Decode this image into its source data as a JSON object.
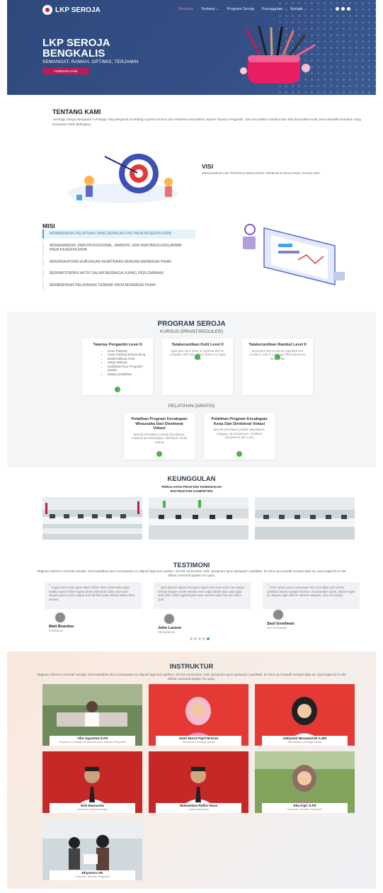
{
  "brand": {
    "name": "LKP SEROJA",
    "accent": "#c2185b",
    "hero_bg": "#344f85"
  },
  "nav": {
    "items": [
      {
        "label": "Beranda",
        "active": true
      },
      {
        "label": "Tentang ⌄",
        "active": false
      },
      {
        "label": "Program Seroja",
        "active": false
      },
      {
        "label": "Keunggulan",
        "active": false
      },
      {
        "label": "Kontak",
        "active": false
      }
    ],
    "social_icons": [
      "twitter-icon",
      "facebook-icon",
      "instagram-icon"
    ]
  },
  "hero": {
    "title": "LKP SEROJA BENGKALIS",
    "subtitle": "SEMANGAT, RAMAH, OPTIMIS, TERJAMIN",
    "button_label": "HUBUNGI KAMI"
  },
  "tentang": {
    "title": "TENTANG KAMI",
    "description": "Lembaga Seroja Merupakan Lembaga Yang Bergerak Di Bidang Layanan Kursus Dan Pelatihan Kecantikan Seperti Tatarias Pengantin, Tata Kecantikan Rambut Dan Tata Kecantikan Kulit, Serta Memiliki Instruktur Yang Kompeten Pada Bidangnya"
  },
  "visi": {
    "title": "VISI",
    "description": "MENJADIKAN LKP TATARIAS PENGANTIN TERBAIK DI RIAU PADA TAHUN 2027"
  },
  "misi": {
    "title": "MISI",
    "items": [
      "MEMBERIKAN PELATIHAN YANG BERKUALITAS PADA PESERTA DIDIK",
      "MENANAMKAN JIWA PROFESIONAL, MANDIRI, DAN BERTANGGUNGJAWAB PADA PESERTA DIDIK",
      "MENINGKATKAN HUBUNGAN KEMITRAAN DENGAN BERBAGAI PIHAK",
      "BERPARTISIPASI AKTIF DALAM BERBAGAI AJANG PERLOMBAAN",
      "MEMBERIKAN PELAYANAN TERBAIK PADA BERBAGAI PIHAK"
    ]
  },
  "program": {
    "title": "PROGRAM SEROJA",
    "kursus_label": "KURSUS (PRIVAT/REGULER)",
    "kursus": [
      {
        "title": "Tatarias Pengantin Level II",
        "items": [
          "Gaun Panjang",
          "Gaun Panjang Berkerudung",
          "Bridal Makeup Artist",
          "Stage Makeup",
          "Modifikasi Riau Pengantin Muslim",
          "Melayu Modifikasi"
        ]
      },
      {
        "title": "Tatakecantikan Kulit Level II",
        "description": "Quis quis nunc dolor in reprehenderit in voluptate velit esse cillum dolore eu fugiat nulla"
      },
      {
        "title": "Tatakecantikan Rambut Level II",
        "description": "Excepteur sint occaecat cupidatat non proident, sunt in culpa qui officia deserunt mollit anim"
      }
    ],
    "pelatihan_label": "PELATIHAN (GRATIS)",
    "pelatihan": [
      {
        "title": "Pelatihan Program Kecakapan Wirausaha Dari Direktorat Vokasi",
        "description": "Benefit (Peralatan praktek disediakan, evaluasi pendampingan, diberikan modal usaha)"
      },
      {
        "title": "Pelatihan Program Kecakapan Kerja Dari Direktorat Vokasi",
        "description": "Benefit (Peralatan praktek disediakan, magang, uji kompetensi, sertifikat kompetensi dari LSK)"
      }
    ]
  },
  "keunggulan": {
    "title": "KEUNGGULAN",
    "subtitle_1": "PERALATAN PRAKTEK DISEDIAKAN",
    "subtitle_2": "INSTRUKTUR KOMPETEN"
  },
  "testimoni": {
    "title": "TESTIMONI",
    "lead": "Magnam dolores commodi suscipit. Necessitatibus eius consequatur ex aliquid fuga eum quidem. Sit sint consectetur velit. Quisquam quos quisquam cupiditate. Et nemo qui impedit suscipit alias ea. Quia fugiat sit in iste officiis commodi quidem hic quas.",
    "items": [
      {
        "quote": "Fugiat enim eram quae cillum dolore dolor amet nulla culpa multos export minim fugiat minim velit minim dolor enim duis veniam ipsum anim magna sunt elit fore quem dolore labore illum veniam.",
        "name": "Matt Brandon",
        "role": "Freelancer"
      },
      {
        "quote": "Quis quorum aliqua sint quem legam fore sunt eram irure aliqua veniam tempor noster veniam enim culpa labore duis sunt culpa nulla illum cillum fugiat legam esse veniam culpa fore nisi cillum quid.",
        "name": "John Larson",
        "role": "Entrepreneur"
      },
      {
        "quote": "Proin iaculis purus consequat sem cure digni ssim donec porttitora entum suscipit rhoncus. Accusantium quam, ultricies eget id, aliquam eget nibh et. Maecen aliquam, risus at semper.",
        "name": "Saul Goodman",
        "role": "Ceo & Founder"
      }
    ],
    "pager": [
      false,
      false,
      false,
      false,
      true
    ]
  },
  "instruktur": {
    "title": "INSTRUKTUR",
    "lead": "Magnam dolores commodi suscipit. Necessitatibus eius consequatur ex aliquid fuga eum quidem. Sit sint consectetur velit. Quisquam quos quisquam cupiditate. Et nemo qui impedit suscipit alias ea. Quia fugiat sit in iste officiis commodi quidem hic quas.",
    "people": [
      {
        "name": "Tilin Agustina S.Pd",
        "role": "Pimpinan Lembaga Seroja/Instruktur Tatarias Pengantin"
      },
      {
        "name": "Sasti Nurul Fiqrii M.Kom",
        "role": "Sekretaris Lembaga Seroja"
      },
      {
        "name": "Zakiyatul Munawaroh A.Md",
        "role": "Bendahara Lembaga Seroja"
      },
      {
        "name": "Erik Maunanta",
        "role": "Instruktur Kewirausahaan"
      },
      {
        "name": "Muhaimina Ridho Nosa",
        "role": "Digital Marketing"
      },
      {
        "name": "Eka Fajri S.Pd",
        "role": "Instruktur Tatarias Pengantin"
      },
      {
        "name": "Etiyonora SE",
        "role": "Instruktur Tatarias Pengantin"
      }
    ]
  }
}
